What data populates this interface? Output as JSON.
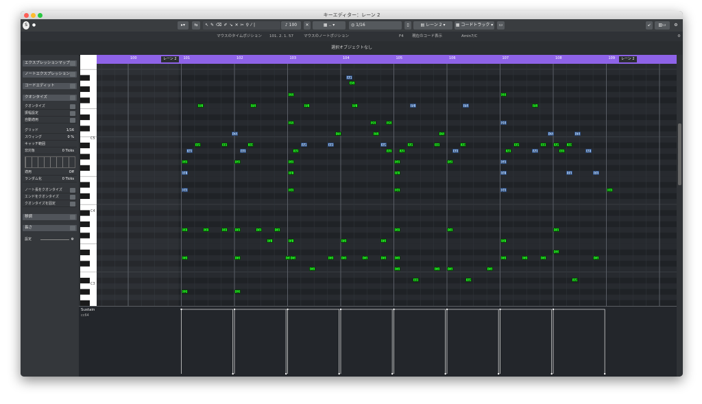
{
  "window": {
    "title": "キーエディター：レーン 2"
  },
  "toolbar": {
    "velocity": "100",
    "quantize": "1/16",
    "track": "レーン 2",
    "chord_track": "コードトラック"
  },
  "infobar": {
    "mouse_time_label": "マウスのタイムポジション",
    "mouse_time_value": "101. 2. 1. 57",
    "mouse_note_label": "マウスのノートポジション",
    "note_value": "F4",
    "chord_label": "現在のコード表示",
    "chord_value": "Amin7/C"
  },
  "status": {
    "text": "選択オブジェクトなし"
  },
  "inspector": {
    "expression_map": "エクスプレッションマップ",
    "note_expression": "ノートエクスプレッション",
    "chord_edit": "コードエディット",
    "quantize": "クオンタイズ",
    "rows": [
      {
        "label": "クオンタイズ",
        "value": ""
      },
      {
        "label": "振幅設定",
        "value": ""
      },
      {
        "label": "自動適用",
        "value": ""
      },
      {
        "label": "グリッド",
        "value": "1/16"
      },
      {
        "label": "スウィング",
        "value": "0 %"
      },
      {
        "label": "キャッチ範囲",
        "value": ""
      },
      {
        "label": "非対象",
        "value": "0 Ticks"
      }
    ],
    "rows2": [
      {
        "label": "適用",
        "value": "Off"
      },
      {
        "label": "ランダム化",
        "value": "0 Ticks"
      }
    ],
    "actions": [
      "ノート長をクオンタイズ",
      "エンドをクオンタイズ",
      "クオンタイズを固定"
    ],
    "transpose": "移調",
    "length": "長さ",
    "settings": "設定"
  },
  "ruler": {
    "bars": [
      "100",
      "101",
      "102",
      "103",
      "104",
      "105",
      "106",
      "107",
      "108",
      "109"
    ],
    "part_label": "レーン 2"
  },
  "keyboard": {
    "labels": [
      "C5",
      "C4",
      "C3"
    ]
  },
  "controller": {
    "name": "Sustain",
    "cc": "cc64"
  },
  "notes": [
    {
      "l": "A#5",
      "b": 104.1,
      "p": 82,
      "c": "b"
    },
    {
      "l": "A5",
      "b": 104.15,
      "p": 81,
      "c": "g"
    },
    {
      "l": "G5",
      "b": 103.0,
      "p": 79,
      "c": "g"
    },
    {
      "l": "G5",
      "b": 107.0,
      "p": 79,
      "c": "g"
    },
    {
      "l": "F5",
      "b": 101.3,
      "p": 77,
      "c": "g"
    },
    {
      "l": "F5",
      "b": 102.3,
      "p": 77,
      "c": "g"
    },
    {
      "l": "F5",
      "b": 103.3,
      "p": 77,
      "c": "g"
    },
    {
      "l": "F5",
      "b": 104.2,
      "p": 77,
      "c": "g"
    },
    {
      "l": "F5",
      "b": 105.3,
      "p": 77,
      "c": "b"
    },
    {
      "l": "F5",
      "b": 106.3,
      "p": 77,
      "c": "b"
    },
    {
      "l": "F5",
      "b": 107.6,
      "p": 77,
      "c": "g"
    },
    {
      "l": "D5",
      "b": 103.0,
      "p": 74,
      "c": "g"
    },
    {
      "l": "D5",
      "b": 104.55,
      "p": 74,
      "c": "g"
    },
    {
      "l": "D5",
      "b": 104.85,
      "p": 74,
      "c": "g"
    },
    {
      "l": "D5",
      "b": 107.0,
      "p": 74,
      "c": "b"
    },
    {
      "l": "C5",
      "b": 101.95,
      "p": 72,
      "c": "b"
    },
    {
      "l": "C5",
      "b": 103.9,
      "p": 72,
      "c": "g"
    },
    {
      "l": "C5",
      "b": 104.6,
      "p": 72,
      "c": "g"
    },
    {
      "l": "C5",
      "b": 105.85,
      "p": 72,
      "c": "g"
    },
    {
      "l": "C5",
      "b": 107.9,
      "p": 72,
      "c": "b"
    },
    {
      "l": "C5",
      "b": 108.4,
      "p": 72,
      "c": "b"
    },
    {
      "l": "A#4",
      "b": 101.25,
      "p": 70,
      "c": "g"
    },
    {
      "l": "A#4",
      "b": 101.75,
      "p": 70,
      "c": "g"
    },
    {
      "l": "A#4",
      "b": 102.25,
      "p": 70,
      "c": "g"
    },
    {
      "l": "A#4",
      "b": 103.25,
      "p": 70,
      "c": "b"
    },
    {
      "l": "A#4",
      "b": 103.75,
      "p": 70,
      "c": "b"
    },
    {
      "l": "A#4",
      "b": 104.75,
      "p": 70,
      "c": "b"
    },
    {
      "l": "A#4",
      "b": 105.25,
      "p": 70,
      "c": "g"
    },
    {
      "l": "A#4",
      "b": 105.75,
      "p": 70,
      "c": "g"
    },
    {
      "l": "A#4",
      "b": 106.25,
      "p": 70,
      "c": "g"
    },
    {
      "l": "A#4",
      "b": 107.25,
      "p": 70,
      "c": "g"
    },
    {
      "l": "A#4",
      "b": 107.75,
      "p": 70,
      "c": "g"
    },
    {
      "l": "A#4",
      "b": 108.0,
      "p": 70,
      "c": "g"
    },
    {
      "l": "A#4",
      "b": 108.25,
      "p": 70,
      "c": "g"
    },
    {
      "l": "A4",
      "b": 101.1,
      "p": 69,
      "c": "b"
    },
    {
      "l": "A4",
      "b": 102.1,
      "p": 69,
      "c": "b"
    },
    {
      "l": "A4",
      "b": 103.1,
      "p": 69,
      "c": "g"
    },
    {
      "l": "A4",
      "b": 104.85,
      "p": 69,
      "c": "g"
    },
    {
      "l": "A4",
      "b": 105.1,
      "p": 69,
      "c": "g"
    },
    {
      "l": "A4",
      "b": 106.1,
      "p": 69,
      "c": "b"
    },
    {
      "l": "A4",
      "b": 107.1,
      "p": 69,
      "c": "g"
    },
    {
      "l": "A4",
      "b": 107.6,
      "p": 69,
      "c": "b"
    },
    {
      "l": "A4",
      "b": 108.1,
      "p": 69,
      "c": "g"
    },
    {
      "l": "A4",
      "b": 108.6,
      "p": 69,
      "c": "b"
    },
    {
      "l": "G4",
      "b": 101.0,
      "p": 67,
      "c": "g"
    },
    {
      "l": "G4",
      "b": 102.0,
      "p": 67,
      "c": "g"
    },
    {
      "l": "G4",
      "b": 103.0,
      "p": 67,
      "c": "g"
    },
    {
      "l": "G4",
      "b": 105.0,
      "p": 67,
      "c": "g"
    },
    {
      "l": "G4",
      "b": 106.0,
      "p": 67,
      "c": "g"
    },
    {
      "l": "G4",
      "b": 107.0,
      "p": 67,
      "c": "b"
    },
    {
      "l": "F4",
      "b": 101.0,
      "p": 65,
      "c": "b"
    },
    {
      "l": "F4",
      "b": 103.0,
      "p": 65,
      "c": "g"
    },
    {
      "l": "F4",
      "b": 105.0,
      "p": 65,
      "c": "g"
    },
    {
      "l": "F4",
      "b": 107.0,
      "p": 65,
      "c": "b"
    },
    {
      "l": "F4",
      "b": 108.25,
      "p": 65,
      "c": "b"
    },
    {
      "l": "F4",
      "b": 108.75,
      "p": 65,
      "c": "b"
    },
    {
      "l": "D4",
      "b": 101.0,
      "p": 62,
      "c": "b"
    },
    {
      "l": "D4",
      "b": 103.0,
      "p": 62,
      "c": "g"
    },
    {
      "l": "D4",
      "b": 105.0,
      "p": 62,
      "c": "g"
    },
    {
      "l": "D4",
      "b": 107.0,
      "p": 62,
      "c": "b"
    },
    {
      "l": "D4",
      "b": 109.0,
      "p": 62,
      "c": "g"
    },
    {
      "l": "C4",
      "b": 101.0,
      "p": 55,
      "c": "g"
    },
    {
      "l": "C4",
      "b": 101.4,
      "p": 55,
      "c": "g"
    },
    {
      "l": "C4",
      "b": 101.75,
      "p": 55,
      "c": "g"
    },
    {
      "l": "C4",
      "b": 102.0,
      "p": 55,
      "c": "g"
    },
    {
      "l": "C4",
      "b": 102.4,
      "p": 55,
      "c": "g"
    },
    {
      "l": "C4",
      "b": 102.75,
      "p": 55,
      "c": "g"
    },
    {
      "l": "C4",
      "b": 105.0,
      "p": 55,
      "c": "g"
    },
    {
      "l": "C4",
      "b": 106.0,
      "p": 55,
      "c": "g"
    },
    {
      "l": "C4",
      "b": 108.0,
      "p": 55,
      "c": "g"
    },
    {
      "l": "F3",
      "b": 102.6,
      "p": 53,
      "c": "g"
    },
    {
      "l": "F3",
      "b": 103.0,
      "p": 53,
      "c": "g"
    },
    {
      "l": "F3",
      "b": 104.0,
      "p": 53,
      "c": "g"
    },
    {
      "l": "F3",
      "b": 104.75,
      "p": 53,
      "c": "g"
    },
    {
      "l": "F3",
      "b": 107.0,
      "p": 53,
      "c": "g"
    },
    {
      "l": "G3",
      "b": 108.0,
      "p": 51,
      "c": "g"
    },
    {
      "l": "C3",
      "b": 101.0,
      "p": 50,
      "c": "g"
    },
    {
      "l": "C3",
      "b": 102.0,
      "p": 50,
      "c": "g"
    },
    {
      "l": "C3",
      "b": 102.95,
      "p": 50,
      "c": "g"
    },
    {
      "l": "C3",
      "b": 103.05,
      "p": 50,
      "c": "g"
    },
    {
      "l": "C3",
      "b": 103.75,
      "p": 50,
      "c": "g"
    },
    {
      "l": "C3",
      "b": 104.0,
      "p": 50,
      "c": "g"
    },
    {
      "l": "C3",
      "b": 104.4,
      "p": 50,
      "c": "g"
    },
    {
      "l": "C3",
      "b": 104.75,
      "p": 50,
      "c": "g"
    },
    {
      "l": "C3",
      "b": 105.0,
      "p": 50,
      "c": "g"
    },
    {
      "l": "C3",
      "b": 107.0,
      "p": 50,
      "c": "g"
    },
    {
      "l": "C3",
      "b": 107.4,
      "p": 50,
      "c": "g"
    },
    {
      "l": "C3",
      "b": 107.75,
      "p": 50,
      "c": "g"
    },
    {
      "l": "C3",
      "b": 108.75,
      "p": 50,
      "c": "g"
    },
    {
      "l": "C3",
      "b": 103.4,
      "p": 48,
      "c": "g"
    },
    {
      "l": "C3",
      "b": 105.0,
      "p": 48,
      "c": "g"
    },
    {
      "l": "C3",
      "b": 105.75,
      "p": 48,
      "c": "g"
    },
    {
      "l": "C3",
      "b": 106.0,
      "p": 48,
      "c": "g"
    },
    {
      "l": "C3",
      "b": 106.75,
      "p": 48,
      "c": "g"
    },
    {
      "l": "A#2",
      "b": 105.35,
      "p": 46,
      "c": "g"
    },
    {
      "l": "A#2",
      "b": 106.35,
      "p": 46,
      "c": "g"
    },
    {
      "l": "A#2",
      "b": 108.35,
      "p": 46,
      "c": "g"
    },
    {
      "l": "G2",
      "b": 101.0,
      "p": 44,
      "c": "g"
    },
    {
      "l": "G2",
      "b": 102.0,
      "p": 44,
      "c": "g"
    }
  ]
}
